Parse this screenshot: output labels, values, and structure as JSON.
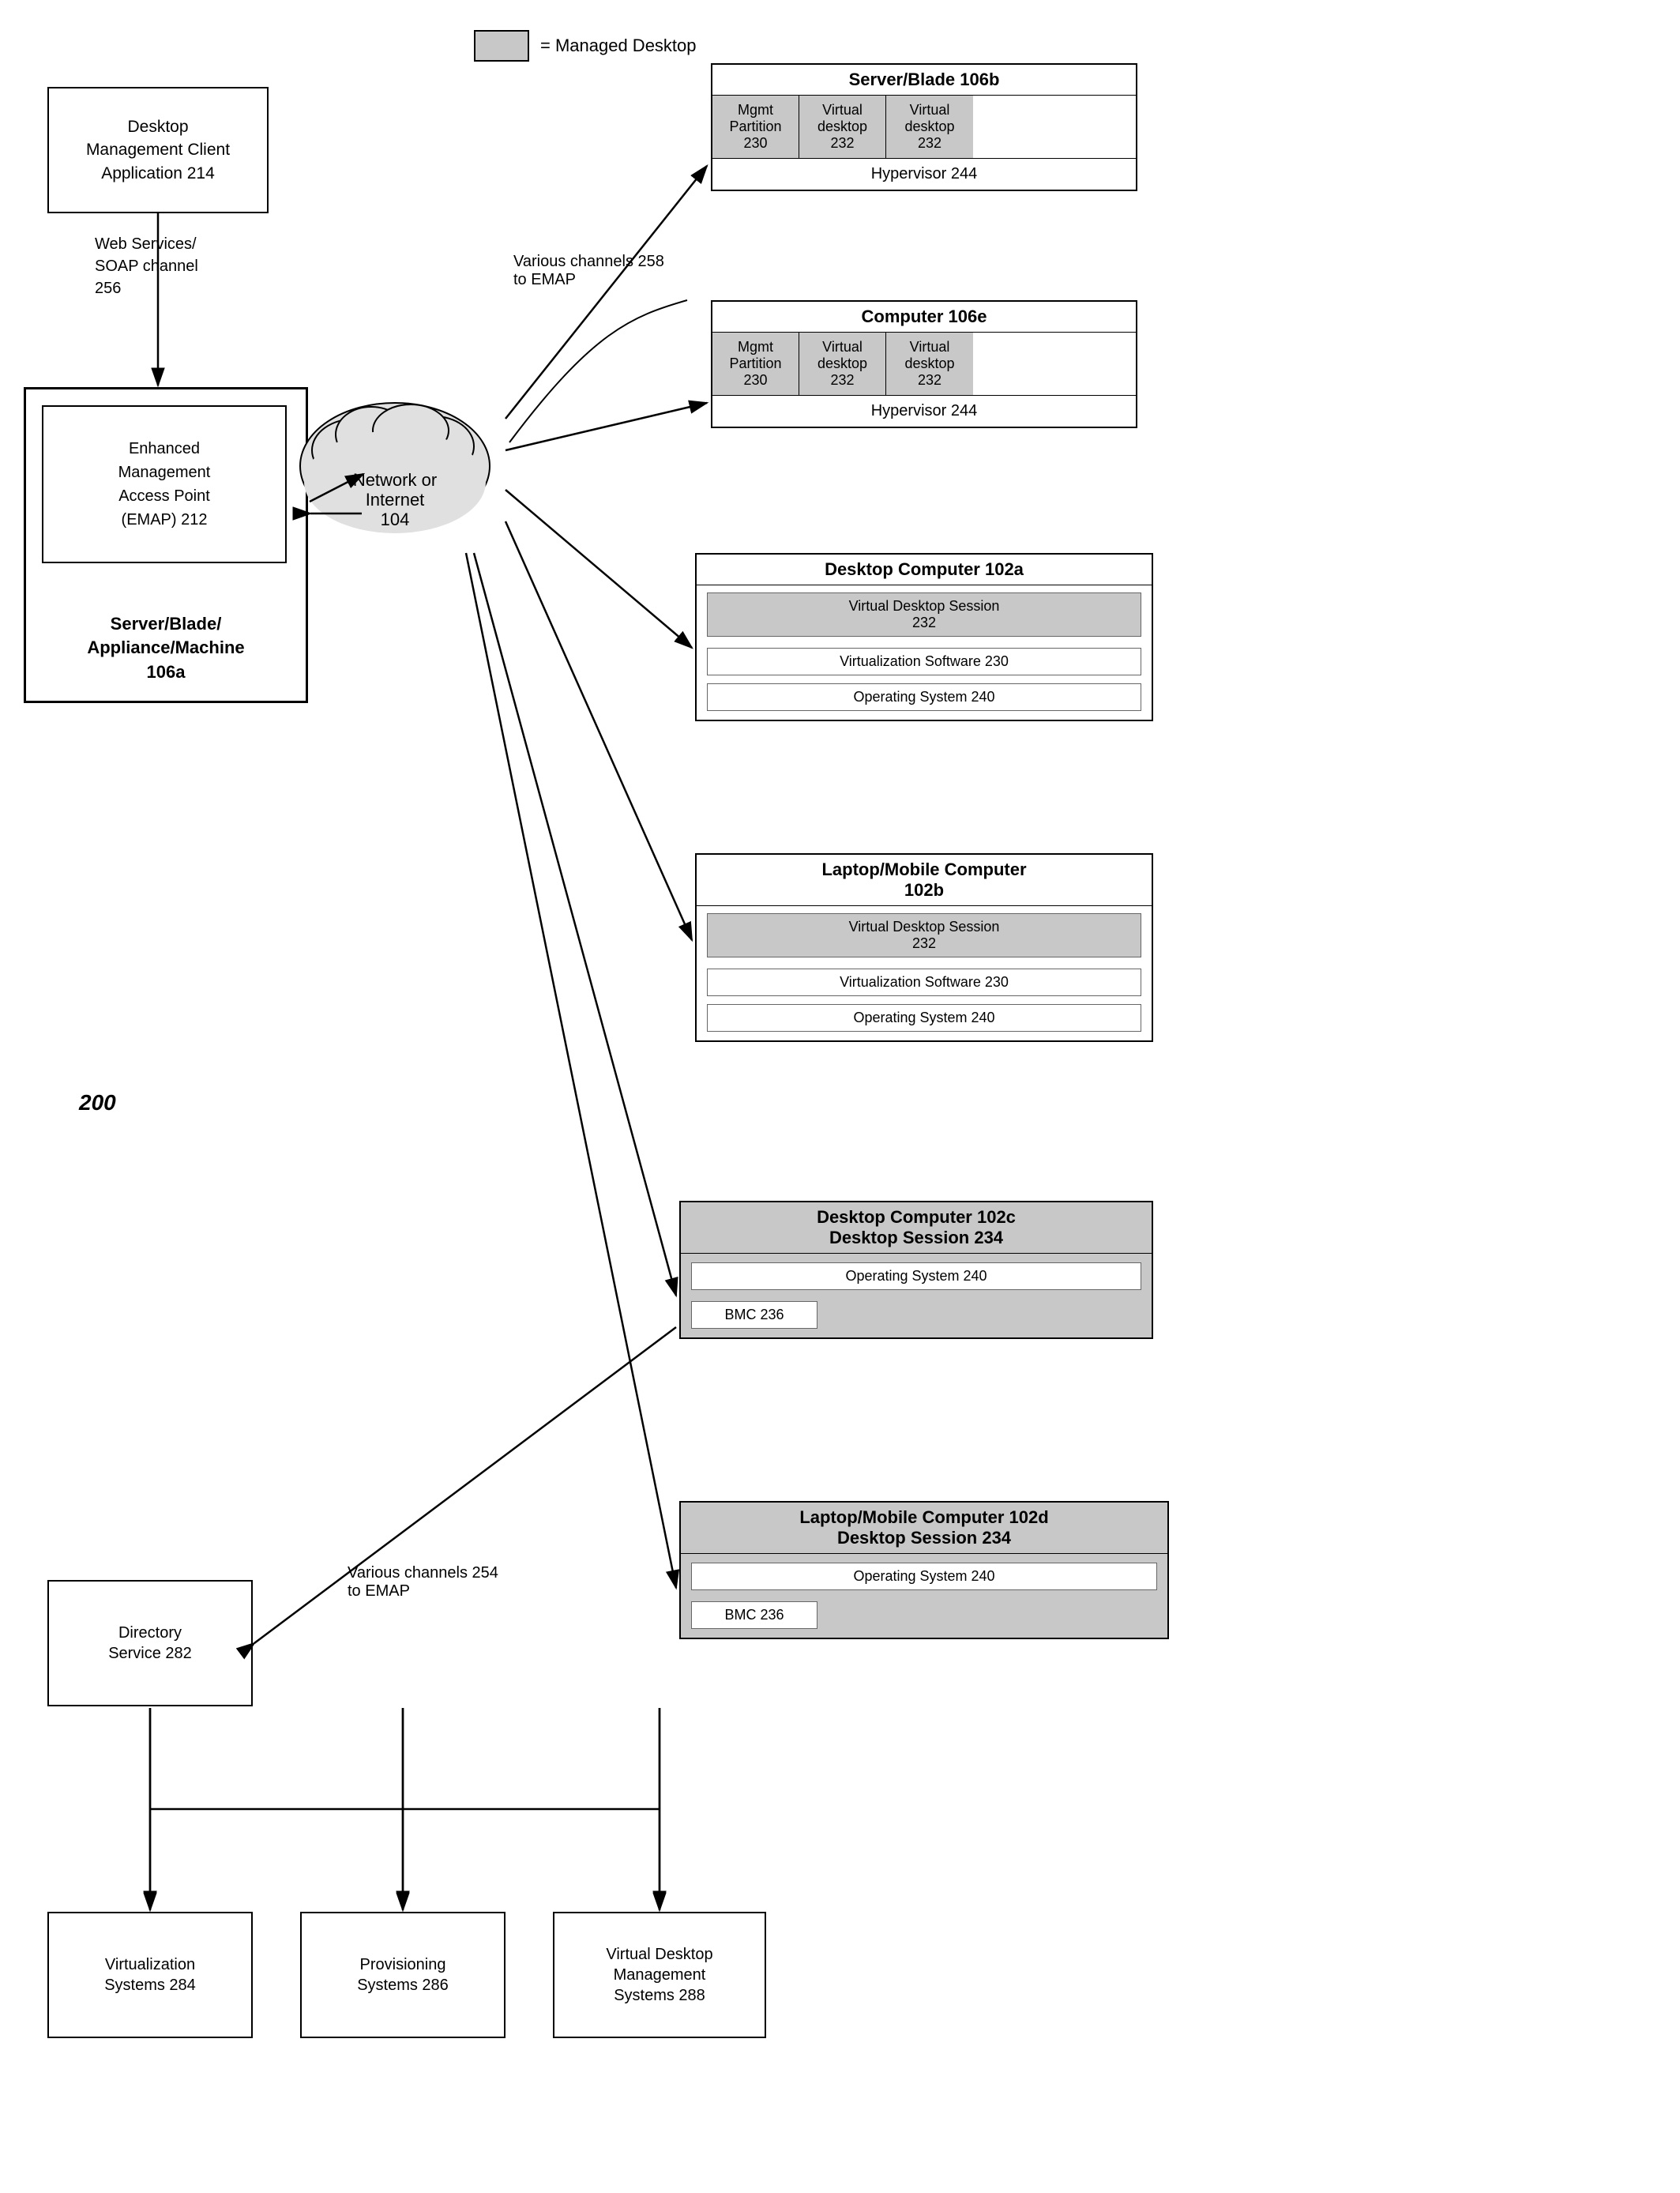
{
  "legend": {
    "text": "= Managed Desktop"
  },
  "diagram_label": "200",
  "nodes": {
    "desktop_mgmt_client": {
      "label": "Desktop\nManagement Client\nApplication 214"
    },
    "emap": {
      "label": "Enhanced\nManagement\nAccess Point\n(EMAP) 212"
    },
    "emap_subtitle": {
      "label": "Server/Blade/\nAppliance/Machine\n106a"
    },
    "network": {
      "label": "Network or\nInternet\n104"
    },
    "web_services": {
      "label": "Web Services/\nSOAP channel\n256"
    },
    "various_channels_258": {
      "label": "Various channels 258\nto EMAP"
    },
    "various_channels_254": {
      "label": "Various channels  254\nto EMAP"
    },
    "server_blade_106b": {
      "title": "Server/Blade 106b",
      "mgmt": "Mgmt\nPartition\n230",
      "vd1": "Virtual\ndesktop\n232",
      "vd2": "Virtual\ndesktop\n232",
      "hypervisor": "Hypervisor 244"
    },
    "computer_106e": {
      "title": "Computer 106e",
      "mgmt": "Mgmt\nPartition\n230",
      "vd1": "Virtual\ndesktop\n232",
      "vd2": "Virtual\ndesktop\n232",
      "hypervisor": "Hypervisor 244"
    },
    "desktop_102a": {
      "title": "Desktop Computer 102a",
      "vds": "Virtual Desktop Session\n232",
      "vs": "Virtualization Software 230",
      "os": "Operating System 240"
    },
    "laptop_102b": {
      "title": "Laptop/Mobile Computer\n102b",
      "vds": "Virtual Desktop Session\n232",
      "vs": "Virtualization Software 230",
      "os": "Operating System 240"
    },
    "desktop_102c": {
      "title": "Desktop Computer 102c\nDesktop Session 234",
      "os": "Operating System 240",
      "bmc": "BMC 236"
    },
    "laptop_102d": {
      "title": "Laptop/Mobile Computer 102d\nDesktop Session 234",
      "os": "Operating System 240",
      "bmc": "BMC 236"
    },
    "directory_service": {
      "label": "Directory\nService 282"
    },
    "virtualization_systems": {
      "label": "Virtualization\nSystems 284"
    },
    "provisioning_systems": {
      "label": "Provisioning\nSystems 286"
    },
    "vdm_systems": {
      "label": "Virtual Desktop\nManagement\nSystems 288"
    }
  }
}
